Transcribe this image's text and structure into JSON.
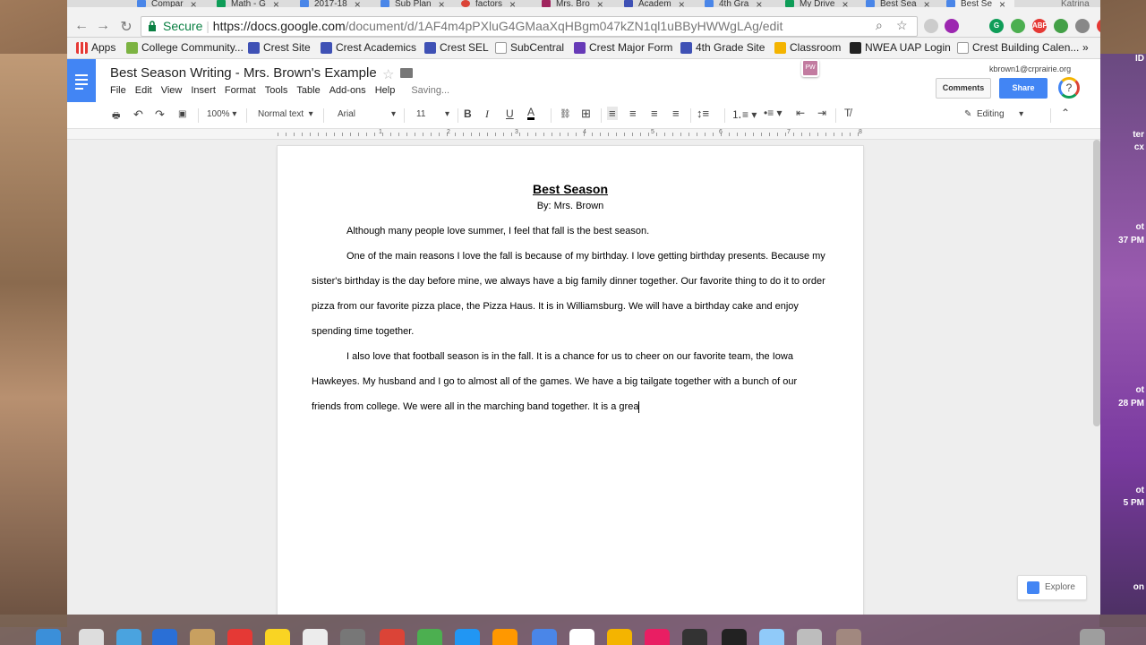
{
  "browser": {
    "tabs": [
      {
        "label": "Compar",
        "icon": "docs-icon",
        "color": "#4a86e8"
      },
      {
        "label": "Math - G",
        "icon": "drive-icon",
        "color": "#0f9d58"
      },
      {
        "label": "2017-18",
        "icon": "docs-icon",
        "color": "#4a86e8"
      },
      {
        "label": "Sub Plan",
        "icon": "docs-icon",
        "color": "#4a86e8"
      },
      {
        "label": "factors",
        "icon": "google-icon",
        "color": "#db4437"
      },
      {
        "label": "Mrs. Bro",
        "icon": "site-icon",
        "color": "#a0245e"
      },
      {
        "label": "Academ",
        "icon": "site-icon",
        "color": "#3f51b5"
      },
      {
        "label": "4th Gra",
        "icon": "docs-icon",
        "color": "#4a86e8"
      },
      {
        "label": "My Drive",
        "icon": "drive-icon",
        "color": "#0f9d58"
      },
      {
        "label": "Best Sea",
        "icon": "docs-icon",
        "color": "#4a86e8"
      },
      {
        "label": "Best Se",
        "icon": "docs-icon",
        "color": "#4a86e8",
        "active": true
      }
    ],
    "profile_name": "Katrina",
    "secure_label": "Secure",
    "url_host": "https://docs.google.com",
    "url_path": "/document/d/1AF4m4pPXluG4GMaaXqHBgm047kZN1ql1uBByHWWgLAg/edit",
    "bookmarks": [
      {
        "label": "Apps",
        "icon": "apps-grid-icon",
        "color": "#888"
      },
      {
        "label": "College Community...",
        "icon": "c-logo-icon",
        "color": "#7cb342"
      },
      {
        "label": "Crest Site",
        "icon": "site-icon",
        "color": "#3f51b5"
      },
      {
        "label": "Crest Academics",
        "icon": "site-icon",
        "color": "#3f51b5"
      },
      {
        "label": "Crest SEL",
        "icon": "site-icon",
        "color": "#3f51b5"
      },
      {
        "label": "SubCentral",
        "icon": "page-icon",
        "color": "#ffffff"
      },
      {
        "label": "Crest Major Form",
        "icon": "form-icon",
        "color": "#673ab7"
      },
      {
        "label": "4th Grade Site",
        "icon": "site-icon",
        "color": "#3f51b5"
      },
      {
        "label": "Classroom",
        "icon": "classroom-icon",
        "color": "#f4b400"
      },
      {
        "label": "NWEA UAP Login",
        "icon": "nwea-icon",
        "color": "#222"
      },
      {
        "label": "Crest Building Calen...",
        "icon": "page-icon",
        "color": "#ffffff"
      }
    ],
    "more_bookmarks": "»"
  },
  "docs": {
    "title": "Best Season Writing - Mrs. Brown's Example",
    "menu": [
      "File",
      "Edit",
      "View",
      "Insert",
      "Format",
      "Tools",
      "Table",
      "Add-ons",
      "Help"
    ],
    "saving": "Saving...",
    "account": "kbrown1@crprairie.org",
    "comments_label": "Comments",
    "share_label": "Share",
    "addon_label": "PW",
    "toolbar": {
      "zoom": "100%",
      "style": "Normal text",
      "font": "Arial",
      "size": "11",
      "mode": "Editing"
    },
    "ruler_numbers": [
      "1",
      "2",
      "3",
      "4",
      "5",
      "6",
      "7",
      "8"
    ],
    "explore_label": "Explore"
  },
  "document": {
    "title": "Best Season",
    "byline": "By: Mrs. Brown",
    "paragraphs": [
      "Although many people love summer, I feel that fall is the best season.",
      "One of the main reasons I love the fall is because of my birthday. I love getting birthday presents. Because my sister's birthday is the day before mine, we always have a big family dinner together. Our favorite thing to do it to order pizza from our favorite pizza place, the Pizza Haus. It is in Williamsburg. We will have a birthday cake and enjoy spending time together.",
      "I also love that football season is in the fall. It is a chance for us to cheer on our favorite team, the Iowa Hawkeyes. My husband and I go to almost all of the games. We have a big tailgate together with a bunch of our friends from college. We were all in the marching band together. It is a grea"
    ]
  },
  "desktop": {
    "right_labels": [
      "ID",
      "ter",
      "cx",
      "ot",
      "37 PM",
      "ot",
      "28 PM",
      "ot",
      "5 PM",
      "on"
    ]
  }
}
